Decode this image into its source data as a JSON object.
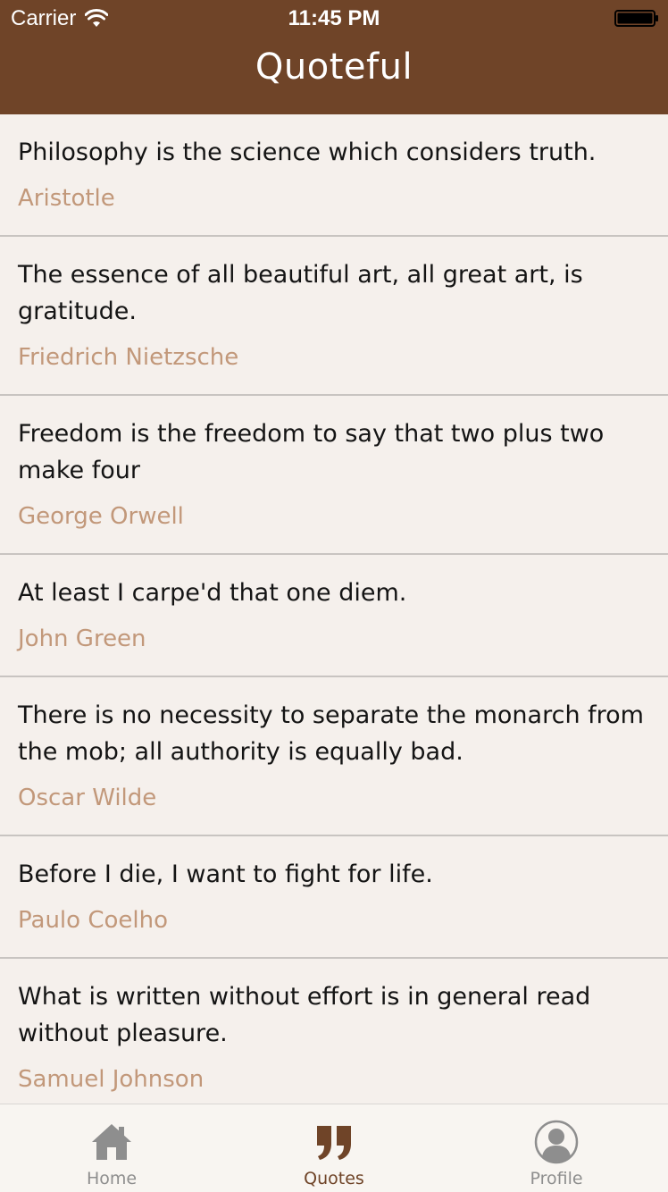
{
  "status_bar": {
    "carrier": "Carrier",
    "time": "11:45 PM"
  },
  "nav": {
    "title": "Quoteful"
  },
  "colors": {
    "brand": "#6f4428",
    "author": "#c2987a",
    "background": "#f5f0ec"
  },
  "quotes": [
    {
      "text": "Philosophy is the science which considers truth.",
      "author": "Aristotle"
    },
    {
      "text": "The essence of all beautiful art, all great art, is gratitude.",
      "author": "Friedrich Nietzsche"
    },
    {
      "text": "Freedom is the freedom to say that two plus two make four",
      "author": "George Orwell"
    },
    {
      "text": "At least I carpe'd that one diem.",
      "author": "John Green"
    },
    {
      "text": "There is no necessity to separate the monarch from the mob; all authority is equally bad.",
      "author": "Oscar Wilde"
    },
    {
      "text": "Before I die, I want to fight for life.",
      "author": "Paulo Coelho"
    },
    {
      "text": "What is written without effort is in general read without pleasure.",
      "author": "Samuel Johnson"
    }
  ],
  "tabs": [
    {
      "label": "Home",
      "icon": "home-icon",
      "active": false
    },
    {
      "label": "Quotes",
      "icon": "quote-icon",
      "active": true
    },
    {
      "label": "Profile",
      "icon": "profile-icon",
      "active": false
    }
  ]
}
